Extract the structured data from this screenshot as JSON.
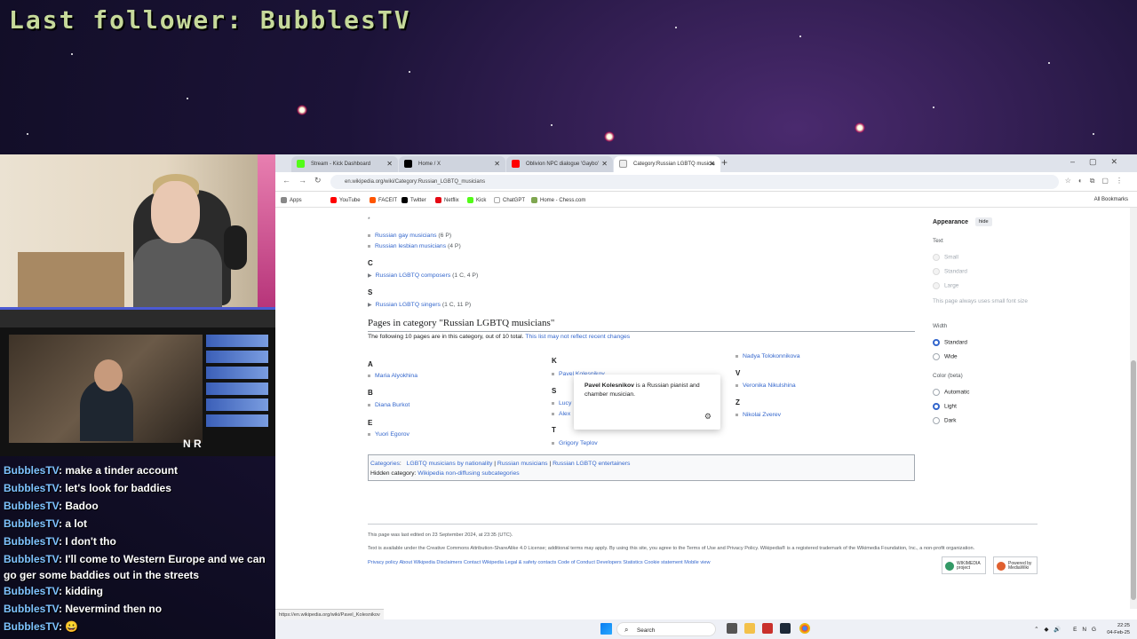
{
  "overlay": {
    "last_follower": "Last follower: BubblesTV"
  },
  "chat": [
    {
      "user": "BubblesTV",
      "msg": ": make a tinder account"
    },
    {
      "user": "BubblesTV",
      "msg": ": let's look for baddies"
    },
    {
      "user": "BubblesTV",
      "msg": ": Badoo"
    },
    {
      "user": "BubblesTV",
      "msg": ": a lot"
    },
    {
      "user": "BubblesTV",
      "msg": ": I don't tho"
    },
    {
      "user": "BubblesTV",
      "msg": ": I'll come to Western Europe and we can go ger some baddies out in the streets"
    },
    {
      "user": "BubblesTV",
      "msg": ": kidding"
    },
    {
      "user": "BubblesTV",
      "msg": ": Nevermind then no"
    },
    {
      "user": "BubblesTV",
      "msg": ": 😀"
    }
  ],
  "mini_player": {
    "badge": "N R"
  },
  "browser": {
    "tabs": [
      {
        "label": "Stream - Kick Dashboard",
        "color": "#53fc18"
      },
      {
        "label": "Home / X",
        "color": "#000000"
      },
      {
        "label": "Oblivion NPC dialogue 'Gaybo'",
        "color": "#ff0000"
      },
      {
        "label": "Category:Russian LGBTQ musicia",
        "color": "#ffffff"
      }
    ],
    "url": "en.wikipedia.org/wiki/Category:Russian_LGBTQ_musicians",
    "bookmarks": [
      {
        "label": "Apps",
        "color": "#888888"
      },
      {
        "label": "YouTube",
        "color": "#ff0000"
      },
      {
        "label": "FACEIT",
        "color": "#ff5500"
      },
      {
        "label": "Twitter",
        "color": "#000000"
      },
      {
        "label": "Netflix",
        "color": "#e50914"
      },
      {
        "label": "Kick",
        "color": "#53fc18"
      },
      {
        "label": "ChatGPT",
        "color": "#ffffff"
      },
      {
        "label": "Home - Chess.com",
        "color": "#7fa650"
      }
    ],
    "all_bookmarks": "All Bookmarks",
    "status_url": "https://en.wikipedia.org/wiki/Pavel_Kolesnikov"
  },
  "wiki": {
    "star": "*",
    "subcats": [
      {
        "label": "Russian gay musicians",
        "count": "(6 P)"
      },
      {
        "label": "Russian lesbian musicians",
        "count": "(4 P)"
      }
    ],
    "letter_c": "C",
    "composers": {
      "label": "Russian LGBTQ composers",
      "count": "(1 C, 4 P)"
    },
    "letter_s": "S",
    "singers": {
      "label": "Russian LGBTQ singers",
      "count": "(1 C, 11 P)"
    },
    "pages_heading": "Pages in category \"Russian LGBTQ musicians\"",
    "intro": "The following 10 pages are in this category, out of 10 total.",
    "intro_link": "This list may not reflect recent changes",
    "columns": {
      "a": {
        "letter": "A",
        "item": "Maria Alyokhina"
      },
      "b": {
        "letter": "B",
        "item": "Diana Burkot"
      },
      "e": {
        "letter": "E",
        "item": "Yuori Egorov"
      },
      "k": {
        "letter": "K",
        "item": "Pavel Kolesnikov"
      },
      "s2": {
        "letter": "S",
        "item1": "Lucy",
        "item2": "Alex"
      },
      "t": {
        "letter": "T",
        "item": "Grigory Teplov"
      },
      "top3": {
        "item": "Nadya Tolokonnikova"
      },
      "v": {
        "letter": "V",
        "item": "Veronika Nikulshina"
      },
      "z": {
        "letter": "Z",
        "item": "Nikolai Zverev"
      }
    },
    "popup": {
      "name": "Pavel Kolesnikov",
      "text": " is a Russian pianist and chamber musician."
    },
    "categories": {
      "label": "Categories",
      "items": [
        "LGBTQ musicians by nationality",
        "Russian musicians",
        "Russian LGBTQ entertainers"
      ],
      "hidden_label": "Hidden category:",
      "hidden_item": "Wikipedia non-diffusing subcategories"
    },
    "footer": {
      "edited": "This page was last edited on 23 September 2024, at 23:35 (UTC).",
      "license": "Text is available under the Creative Commons Attribution-ShareAlike 4.0 License; additional terms may apply. By using this site, you agree to the Terms of Use and Privacy Policy. Wikipedia® is a registered trademark of the Wikimedia Foundation, Inc., a non-profit organization.",
      "links": "Privacy policy   About Wikipedia   Disclaimers   Contact Wikipedia   Legal & safety contacts   Code of Conduct   Developers   Statistics   Cookie statement   Mobile view",
      "badge1": "WIKIMEDIA project",
      "badge2": "Powered by MediaWiki"
    },
    "appearance": {
      "heading": "Appearance",
      "hide": "hide",
      "text_label": "Text",
      "text_opts": [
        "Small",
        "Standard",
        "Large"
      ],
      "note": "This page always uses small font size",
      "width_label": "Width",
      "width_opts": [
        "Standard",
        "Wide"
      ],
      "color_label": "Color (beta)",
      "color_opts": [
        "Automatic",
        "Light",
        "Dark"
      ]
    }
  },
  "taskbar": {
    "search": "Search",
    "lang": "ENG",
    "time": "22:25",
    "date": "04-Feb-25"
  }
}
